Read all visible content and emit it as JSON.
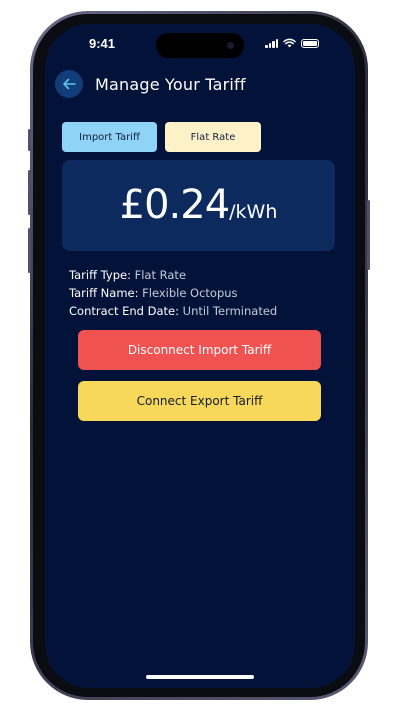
{
  "status_bar": {
    "time": "9:41"
  },
  "header": {
    "title": "Manage Your Tariff",
    "back_icon": "arrow-left-icon"
  },
  "tabs": [
    {
      "label": "Import Tariff",
      "color": "#8fd3f7"
    },
    {
      "label": "Flat Rate",
      "color": "#fdf1c8"
    }
  ],
  "price": {
    "value": "£0.24",
    "unit": "/kWh"
  },
  "details": {
    "tariff_type_label": "Tariff Type:",
    "tariff_type_value": "Flat Rate",
    "tariff_name_label": "Tariff Name:",
    "tariff_name_value": "Flexible Octopus",
    "contract_end_label": "Contract End Date:",
    "contract_end_value": "Until Terminated"
  },
  "actions": {
    "disconnect_label": "Disconnect Import Tariff",
    "connect_label": "Connect Export Tariff"
  },
  "colors": {
    "background": "#021238",
    "card": "#0c2a5e",
    "disconnect": "#f05252",
    "connect": "#f7d85a",
    "back_button": "#113e78"
  }
}
